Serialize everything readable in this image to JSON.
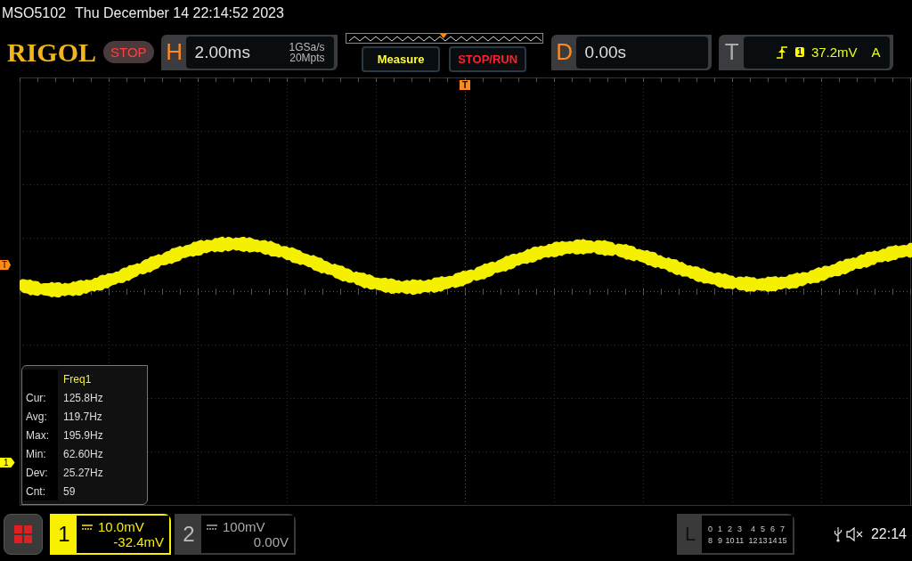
{
  "header": {
    "model": "MSO5102",
    "datetime": "Thu December 14 22:14:52 2023"
  },
  "toolbar": {
    "logo": "RIGOL",
    "run_status": "STOP",
    "horizontal": {
      "label": "H",
      "timebase": "2.00ms",
      "sample_rate": "1GSa/s",
      "memory_depth": "20Mpts"
    },
    "buttons": [
      "Measure",
      "STOP/RUN"
    ],
    "delay": {
      "label": "D",
      "value": "0.00s"
    },
    "trigger": {
      "label": "T",
      "source": "1",
      "level": "37.2mV",
      "mode": "A"
    }
  },
  "screen": {
    "trigger_position_marker": "T",
    "trigger_level_marker": "T",
    "channel_marker": "1",
    "measurement": {
      "title": "Freq1",
      "rows": [
        {
          "label": "Cur:",
          "value": "125.8Hz"
        },
        {
          "label": "Avg:",
          "value": "119.7Hz"
        },
        {
          "label": "Max:",
          "value": "195.9Hz"
        },
        {
          "label": "Min:",
          "value": "62.60Hz"
        },
        {
          "label": "Dev:",
          "value": "25.27Hz"
        },
        {
          "label": "Cnt:",
          "value": "59"
        }
      ]
    }
  },
  "channels": [
    {
      "number": "1",
      "scale": "10.0mV",
      "offset": "-32.4mV",
      "selected": true
    },
    {
      "number": "2",
      "scale": "100mV",
      "offset": "0.00V",
      "selected": false
    }
  ],
  "logic": {
    "label": "L",
    "rows": [
      [
        "0",
        "1",
        "2",
        "3",
        "4",
        "5",
        "6",
        "7"
      ],
      [
        "8",
        "9",
        "10",
        "11",
        "12",
        "13",
        "14",
        "15"
      ]
    ]
  },
  "status": {
    "time": "22:14"
  }
}
